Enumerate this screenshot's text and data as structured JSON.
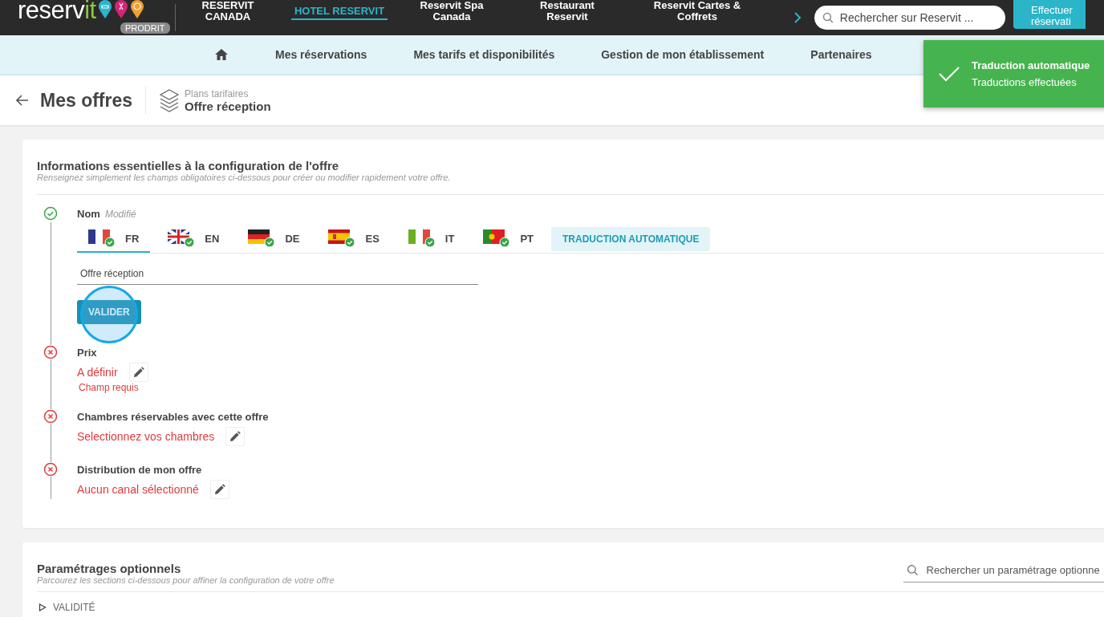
{
  "topbar": {
    "logo_main": "reserv",
    "logo_accent": "it",
    "badge": "PRODRIT",
    "tabs": [
      {
        "label": "RESERVIT CANADA",
        "selected": false
      },
      {
        "label": "HOTEL RESERVIT",
        "selected": true
      },
      {
        "label": "Reservit Spa Canada",
        "selected": false
      },
      {
        "label": "Restaurant Reservit",
        "selected": false
      },
      {
        "label": "Reservit Cartes & Coffrets",
        "selected": false
      }
    ],
    "search": {
      "placeholder": "Rechercher sur Reservit ..."
    },
    "action_button": "Effectuer réservati"
  },
  "menu": [
    "Mes réservations",
    "Mes tarifs et disponibilités",
    "Gestion de mon établissement",
    "Partenaires"
  ],
  "toast": {
    "title": "Traduction automatique",
    "message": "Traductions effectuées"
  },
  "page_header": {
    "title": "Mes offres",
    "breadcrumb_parent": "Plans tarifaires",
    "breadcrumb_current": "Offre réception"
  },
  "essentials": {
    "title": "Informations essentielles à la configuration de l'offre",
    "subtitle": "Renseignez simplement les champs obligatoires ci-dessous pour créer ou modifier rapidement votre offre.",
    "steps": [
      {
        "kind": "name",
        "valid": true,
        "label": "Nom",
        "note": "Modifié",
        "languages": [
          {
            "code": "FR",
            "selected": true,
            "translated": true
          },
          {
            "code": "EN",
            "selected": false,
            "translated": true
          },
          {
            "code": "DE",
            "selected": false,
            "translated": true
          },
          {
            "code": "ES",
            "selected": false,
            "translated": true
          },
          {
            "code": "IT",
            "selected": false,
            "translated": true
          },
          {
            "code": "PT",
            "selected": false,
            "translated": true
          }
        ],
        "translate_button": "TRADUCTION AUTOMATIQUE",
        "value": "Offre réception",
        "validate_button": "VALIDER"
      },
      {
        "kind": "field",
        "valid": false,
        "label": "Prix",
        "value": "A définir",
        "error": "Champ requis"
      },
      {
        "kind": "field",
        "valid": false,
        "label": "Chambres réservables avec cette offre",
        "value": "Selectionnez vos chambres"
      },
      {
        "kind": "field",
        "valid": false,
        "label": "Distribution de mon offre",
        "value": "Aucun canal sélectionné"
      }
    ]
  },
  "optional": {
    "title": "Paramétrages optionnels",
    "subtitle": "Parcourez les sections ci-dessous pour affiner la configuration de votre offre",
    "search": {
      "placeholder": "Rechercher un paramétrage optionne"
    },
    "sections": [
      {
        "label": "VALIDITÉ",
        "expanded": false
      }
    ]
  }
}
